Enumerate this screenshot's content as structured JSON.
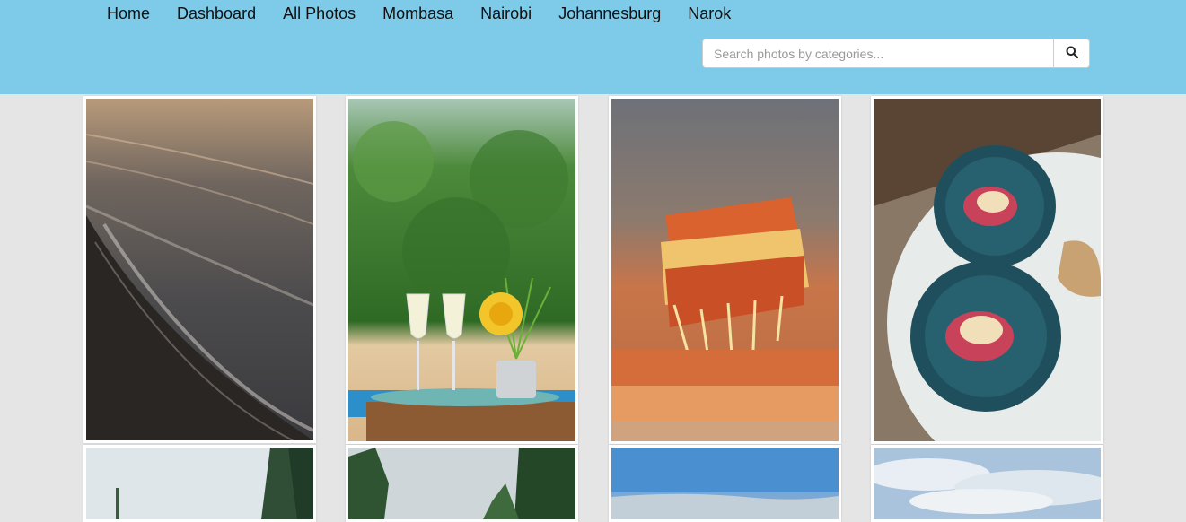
{
  "nav": {
    "links": [
      "Home",
      "Dashboard",
      "All Photos",
      "Mombasa",
      "Nairobi",
      "Johannesburg",
      "Narok"
    ]
  },
  "search": {
    "placeholder": "Search photos by categories...",
    "button_icon": "search-icon"
  },
  "colors": {
    "navbar": "#7ecbe9",
    "page_background": "#e5e5e5"
  },
  "gallery": {
    "photos": [
      {
        "subject": "beach-shore-waves"
      },
      {
        "subject": "champagne-glasses-yellow-rose"
      },
      {
        "subject": "lasagna-cheese-pull"
      },
      {
        "subject": "plated-dish-on-marble-table"
      },
      {
        "subject": "pine-trees-sky"
      },
      {
        "subject": "forest-mountains-clouds"
      },
      {
        "subject": "blue-sky-horizon"
      },
      {
        "subject": "cloudy-sky"
      }
    ]
  }
}
